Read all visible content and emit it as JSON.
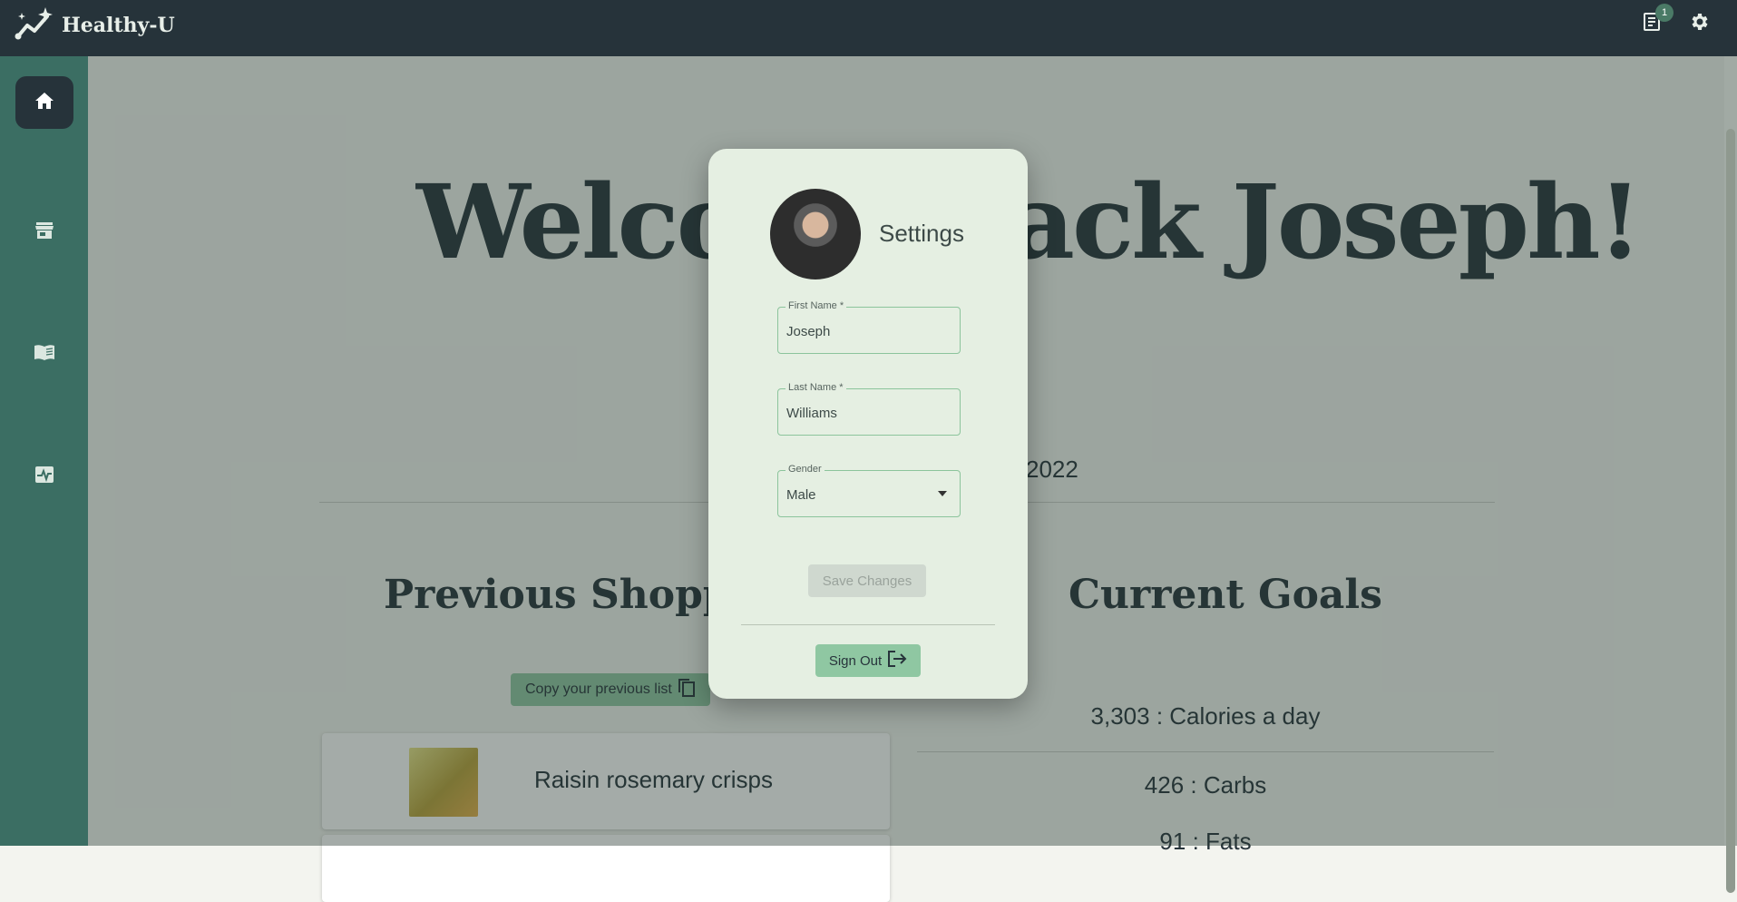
{
  "app": {
    "brand": "Healthy-U",
    "notification_count": "1"
  },
  "main": {
    "welcome": "Welcome back Joseph!",
    "date_fragment": "2022",
    "shopping_title": "Previous Shopping List",
    "copy_button": "Copy your previous list",
    "items": [
      {
        "name": "Raisin rosemary crisps"
      }
    ],
    "goals_title": "Current Goals",
    "goals": [
      "3,303 : Calories a day",
      "426 : Carbs",
      "91 : Fats"
    ]
  },
  "settings_modal": {
    "title": "Settings",
    "first_name": {
      "label": "First Name *",
      "value": "Joseph"
    },
    "last_name": {
      "label": "Last Name *",
      "value": "Williams"
    },
    "gender": {
      "label": "Gender",
      "value": "Male"
    },
    "save_button": "Save Changes",
    "signout_button": "Sign Out"
  },
  "icons": {
    "nav": [
      "home-icon",
      "store-icon",
      "book-icon",
      "health-icon"
    ],
    "top": [
      "notes-icon",
      "gear-icon"
    ]
  },
  "colors": {
    "topbar": "#26333a",
    "sidebar": "#3b6e63",
    "accent": "#8fc7a2",
    "modal": "#e5efe2"
  }
}
